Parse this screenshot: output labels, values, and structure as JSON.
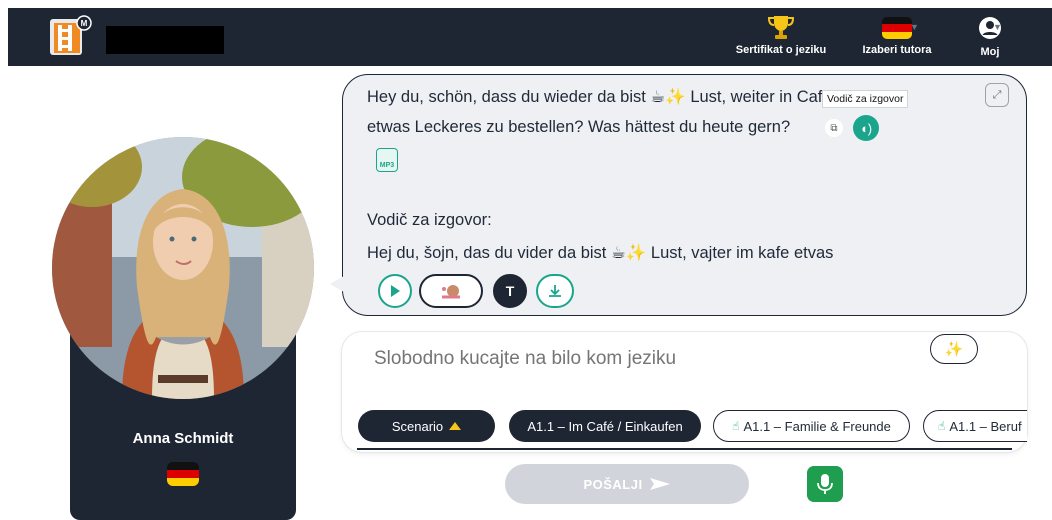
{
  "header": {
    "certificate_label": "Sertifikat o jeziku",
    "choose_tutor_label": "Izaberi tutora",
    "profile_label": "Moj"
  },
  "tutor": {
    "name": "Anna Schmidt"
  },
  "chat": {
    "message_line1": "Hey du, schön, dass du wieder da bist ☕✨ Lust, weiter in Café",
    "message_line2": "etwas Leckeres zu bestellen? Was hättest du heute gern?",
    "tooltip": "Vodič za izgovor",
    "mp3_label": "MP3",
    "guide_heading": "Vodič za izgovor:",
    "guide_line1": "Hej du, šojn, das du vider da bist ☕✨ Lust, vajter im kafe etvas"
  },
  "composer": {
    "placeholder": "Slobodno kucajte na bilo kom jeziku",
    "chips": {
      "scenario": "Scenario",
      "chip1": "A1.1 – Im Café / Einkaufen",
      "chip2": "A1.1 – Familie & Freunde",
      "chip3": "A1.1 – Beruf"
    },
    "send_label": "POŠALJI"
  },
  "colors": {
    "navy": "#1e2533",
    "accent": "#1aa58c",
    "mic": "#1e9e4e"
  }
}
